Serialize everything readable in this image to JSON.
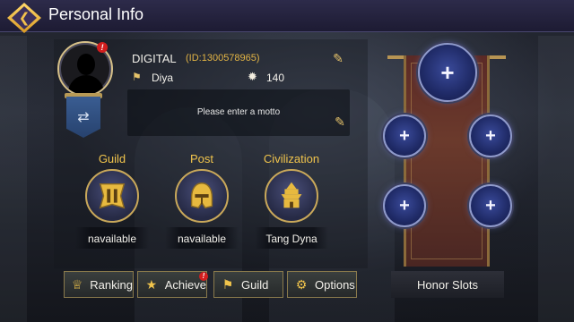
{
  "header": {
    "title": "Personal Info",
    "back_icon": "back-arrow-icon"
  },
  "profile": {
    "name": "DIGITAL",
    "id": "(ID:1300578965)",
    "alliance": "Diya",
    "power": "140",
    "motto_placeholder": "Please enter a motto",
    "avatar_badge": "!"
  },
  "info": [
    {
      "label": "Guild",
      "value": "navailable"
    },
    {
      "label": "Post",
      "value": "navailable"
    },
    {
      "label": "Civilization",
      "value": "Tang Dyna"
    }
  ],
  "buttons": [
    {
      "label": "Ranking",
      "icon": "trophy-icon"
    },
    {
      "label": "Achieve",
      "icon": "star-icon",
      "badge": "!"
    },
    {
      "label": "Guild",
      "icon": "guild-banner-icon"
    },
    {
      "label": "Options",
      "icon": "gear-icon"
    }
  ],
  "honor": {
    "label": "Honor Slots",
    "slot_symbol": "+"
  },
  "colors": {
    "accent_gold": "#f0c44c",
    "id_gold": "#e3b545",
    "notification_red": "#d21e1e",
    "slot_blue": "#1f2a66"
  }
}
